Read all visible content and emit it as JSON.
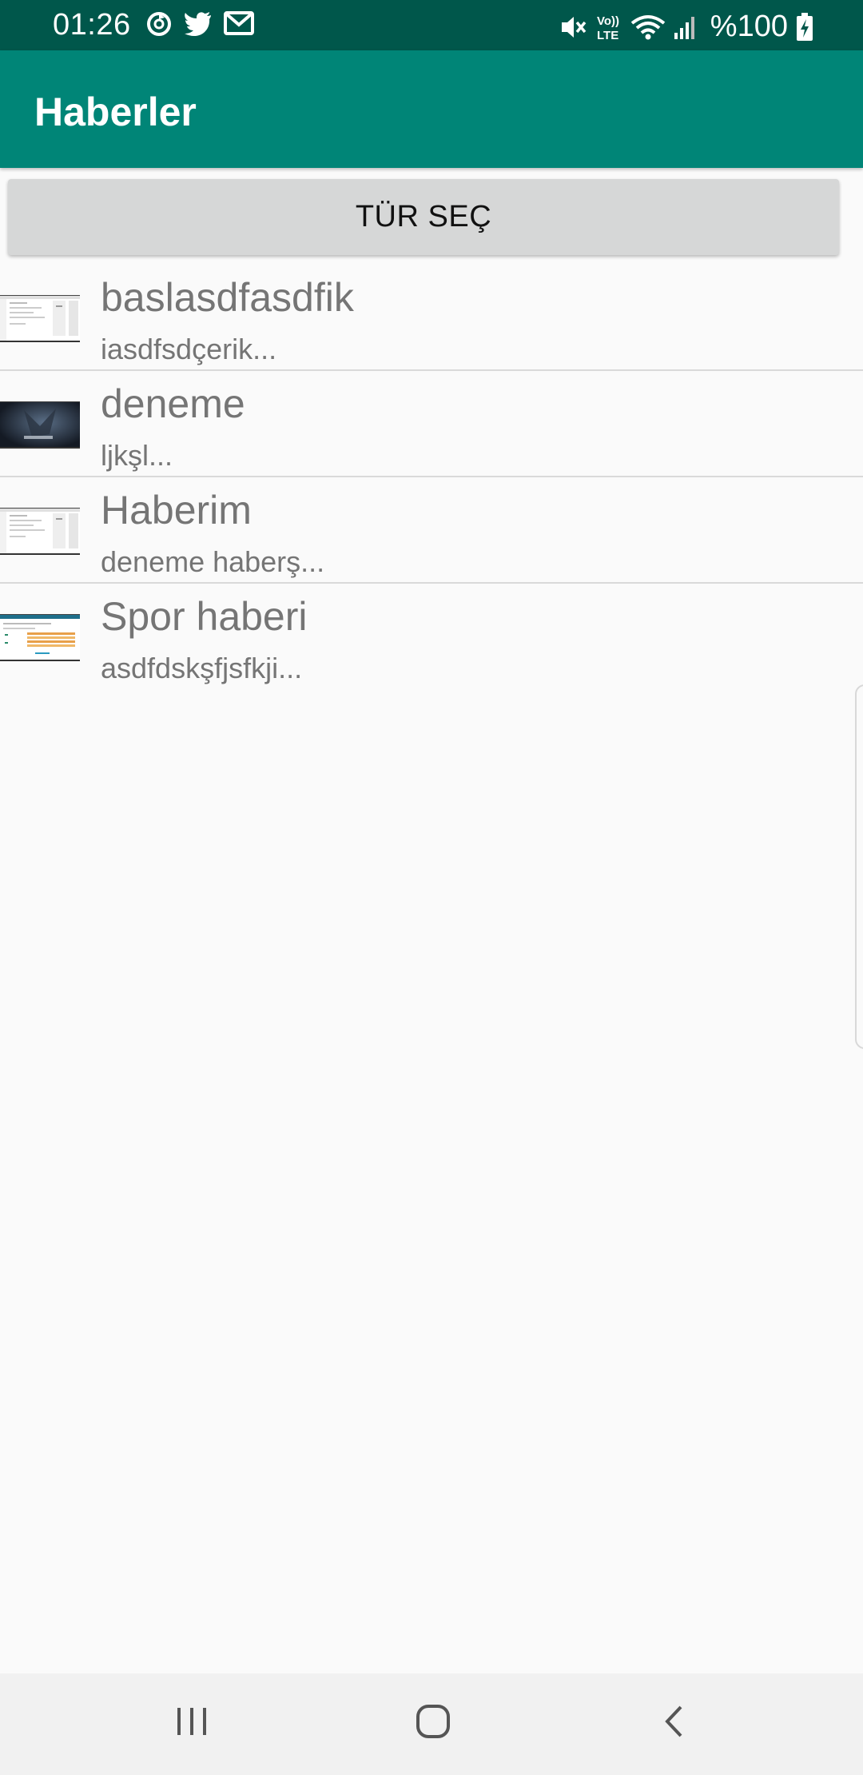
{
  "status_bar": {
    "time": "01:26",
    "left_icons": [
      "sync-icon",
      "twitter-icon",
      "gmail-icon"
    ],
    "right_icons": [
      "mute-icon",
      "volte-icon",
      "wifi-icon",
      "signal-icon",
      "battery-charging-icon"
    ],
    "battery": "%100"
  },
  "app_bar": {
    "title": "Haberler"
  },
  "type_button": {
    "label": "TÜR SEÇ"
  },
  "news": [
    {
      "title": "baslasdfasdfik",
      "snippet": "iasdfsdçerik...",
      "thumbnail": "screenshot-thumbnail"
    },
    {
      "title": "deneme",
      "snippet": "ljkşl...",
      "thumbnail": "witcher-thumbnail"
    },
    {
      "title": "Haberim",
      "snippet": "deneme haberş...",
      "thumbnail": "screenshot-thumbnail"
    },
    {
      "title": "Spor haberi",
      "snippet": "asdfdskşfjsfkji...",
      "thumbnail": "table-thumbnail"
    }
  ],
  "nav_bar": {
    "buttons": [
      "recent-apps-icon",
      "home-icon",
      "back-icon"
    ]
  },
  "colors": {
    "status_bar": "#00574b",
    "app_bar": "#008577",
    "background": "#fafafa",
    "button": "#d6d7d7",
    "text_secondary": "#757575"
  }
}
